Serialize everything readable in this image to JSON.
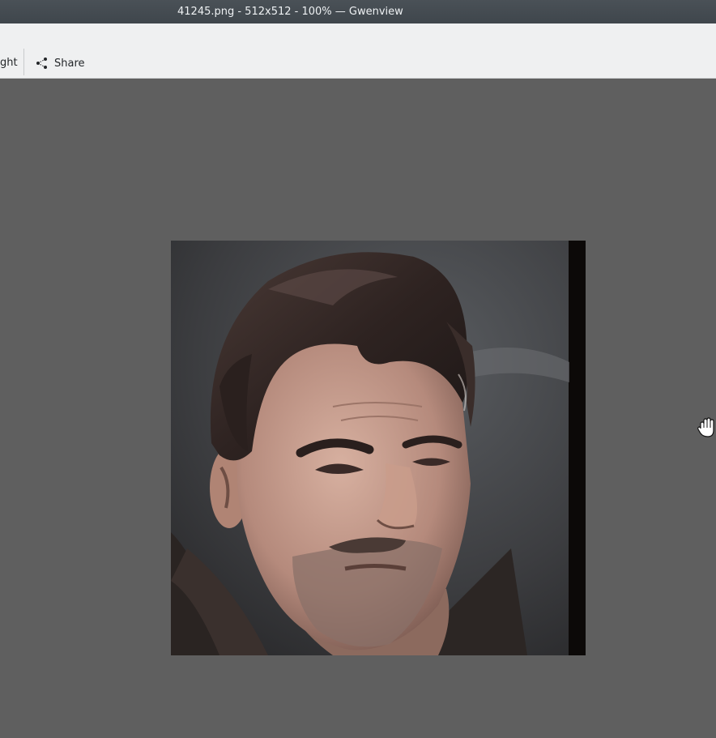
{
  "window": {
    "title": "41245.png - 512x512 - 100% — Gwenview"
  },
  "toolbar": {
    "partial_label": "ght",
    "share_label": "Share",
    "share_icon": "share-icon"
  },
  "viewer": {
    "image_icon": "portrait-image",
    "cursor_icon": "hand-cursor-icon"
  }
}
